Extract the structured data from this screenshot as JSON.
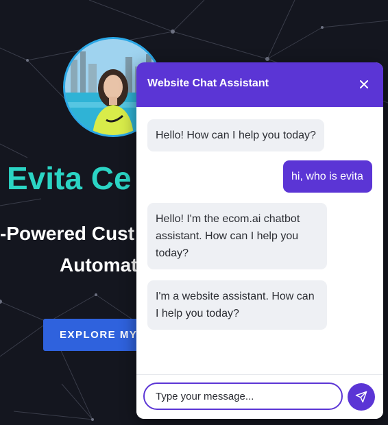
{
  "hero": {
    "name": "Evita Ce",
    "tagline_line1": "-Powered Cust",
    "tagline_line2": "Automat",
    "explore_label": "EXPLORE MY W",
    "avatar_icon": "profile-photo",
    "name_color": "#2bd4c4",
    "button_color": "#2f62dd"
  },
  "chat": {
    "title": "Website Chat Assistant",
    "close_icon": "close-icon",
    "accent_color": "#5b35d5",
    "messages": [
      {
        "role": "bot",
        "text": "Hello! How can I help you today?"
      },
      {
        "role": "user",
        "text": "hi, who is evita"
      },
      {
        "role": "bot",
        "text": "Hello! I'm the ecom.ai chatbot assistant. How can I help you today?"
      },
      {
        "role": "bot",
        "text": "I'm a website assistant. How can I help you today?"
      }
    ],
    "input": {
      "placeholder": "Type your message...",
      "value": ""
    },
    "send_icon": "send-icon"
  }
}
